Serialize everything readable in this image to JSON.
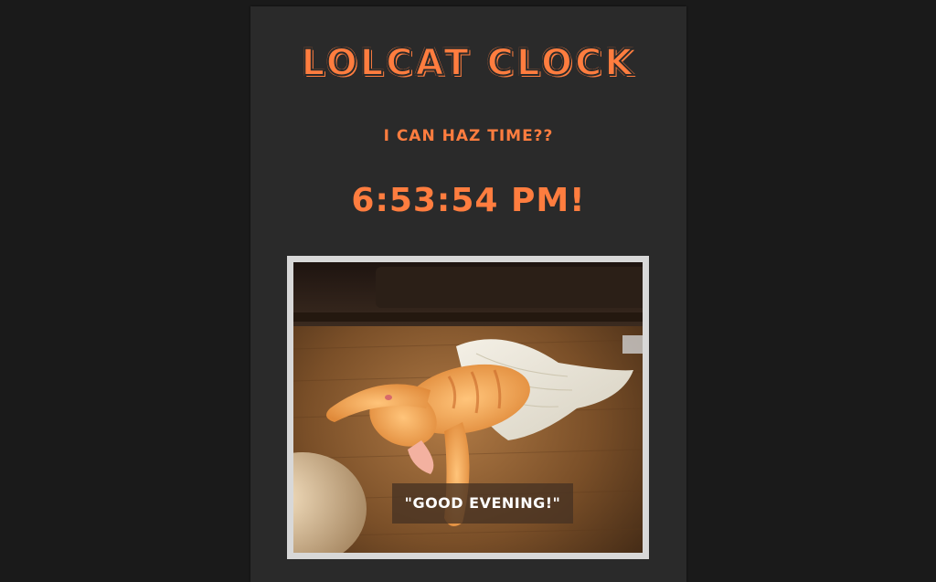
{
  "app": {
    "title": "LOLCAT CLOCK",
    "subtitle": "I CAN HAZ TIME??",
    "time_display": "6:53:54 PM!"
  },
  "image": {
    "caption": "\"GOOD EVENING!\"",
    "subject": "orange cat sleeping on carpet under towel"
  },
  "colors": {
    "page_background": "#1a1a1a",
    "panel_background": "#2a2a2a",
    "accent": "#ff7d3f",
    "frame": "#d8d8d8"
  }
}
